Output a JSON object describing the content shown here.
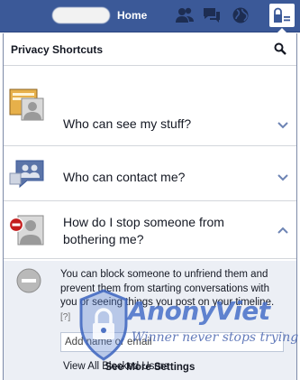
{
  "topbar": {
    "home_label": "Home",
    "icons": [
      "friend-requests-icon",
      "messages-icon",
      "notifications-globe-icon",
      "privacy-shortcuts-icon"
    ]
  },
  "panel": {
    "title": "Privacy Shortcuts",
    "rows": [
      {
        "label": "Who can see my stuff?",
        "icon": "stuff-photo-icon"
      },
      {
        "label": "Who can contact me?",
        "icon": "contact-people-icon"
      },
      {
        "label": "How do I stop someone from bothering me?",
        "icon": "block-user-icon"
      }
    ],
    "expanded": {
      "text": "You can block someone to unfriend them and prevent them from starting conversations with you or seeing things you post on your timeline.",
      "help_link": "[?]",
      "input_placeholder": "Add name or email",
      "blocked_link": "View All Blocked Users"
    },
    "see_more": "See More Settings"
  },
  "watermark": {
    "brand": "AnonyViet",
    "tagline": "Winner never stops trying"
  },
  "colors": {
    "facebook_blue": "#3b5998",
    "panel_expand_bg": "#eceff5",
    "divider": "#d3d6db"
  }
}
